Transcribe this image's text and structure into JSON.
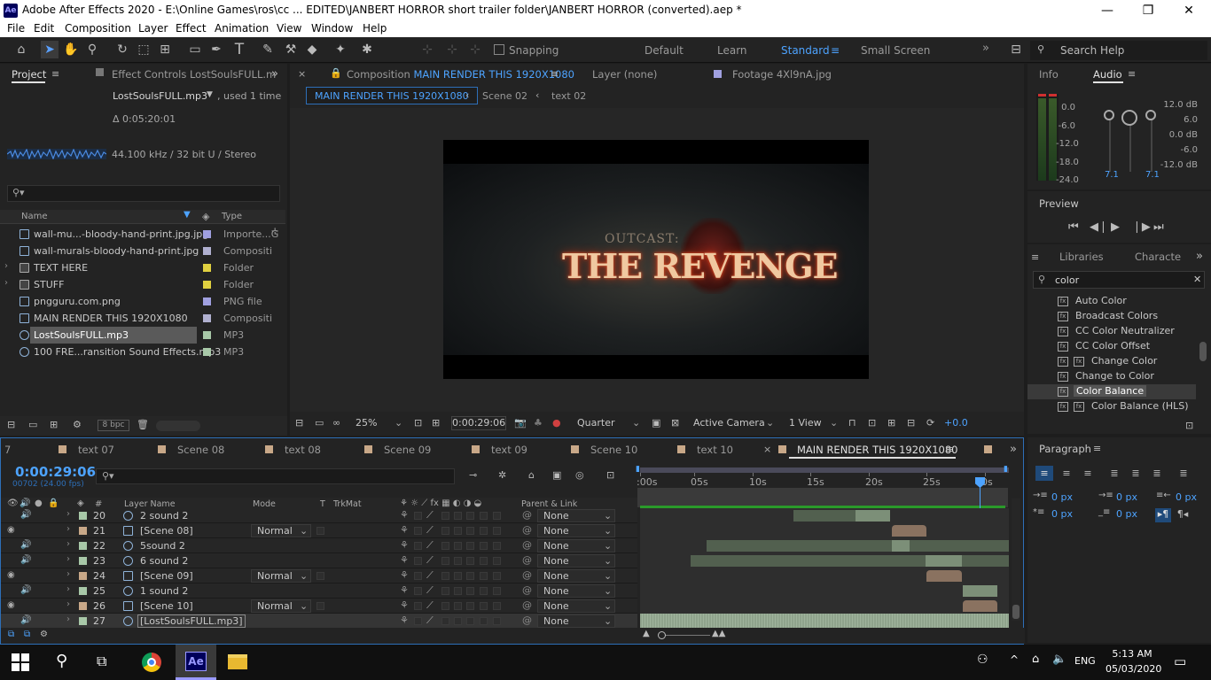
{
  "window": {
    "title": "Adobe After Effects 2020 - E:\\Online Games\\ros\\cc ... EDITED\\JANBERT HORROR short trailer folder\\JANBERT HORROR (converted).aep *",
    "logo": "Ae",
    "min": "—",
    "max": "❐",
    "close": "✕"
  },
  "menu": [
    "File",
    "Edit",
    "Composition",
    "Layer",
    "Effect",
    "Animation",
    "View",
    "Window",
    "Help"
  ],
  "toolbar": {
    "snapping": "Snapping",
    "workspaces": [
      "Default",
      "Learn",
      "Standard",
      "Small Screen"
    ],
    "active_ws": "Standard",
    "search": "Search Help"
  },
  "project": {
    "tab": "Project",
    "effect_tab": "Effect Controls LostSoulsFULL.m",
    "selected_name": "LostSoulsFULL.mp3",
    "used": ", used 1 time",
    "duration": "Δ 0:05:20:01",
    "audio_info": "44.100 kHz / 32 bit U / Stereo",
    "col_name": "Name",
    "col_type": "Type",
    "bpc": "8 bpc",
    "items": [
      {
        "name": "wall-mu...-bloody-hand-print.jpg.jpg",
        "type": "Importe...G",
        "color": "#a0a0e0",
        "kind": "img"
      },
      {
        "name": "wall-murals-bloody-hand-print.jpg",
        "type": "Compositi",
        "color": "#b0b0d0",
        "kind": "comp"
      },
      {
        "name": "TEXT HERE",
        "type": "Folder",
        "color": "#e0d040",
        "kind": "folder"
      },
      {
        "name": "STUFF",
        "type": "Folder",
        "color": "#e0d040",
        "kind": "folder"
      },
      {
        "name": "pngguru.com.png",
        "type": "PNG file",
        "color": "#a0a0e0",
        "kind": "img"
      },
      {
        "name": "MAIN RENDER THIS 1920X1080",
        "type": "Compositi",
        "color": "#b0b0d0",
        "kind": "comp"
      },
      {
        "name": "LostSoulsFULL.mp3",
        "type": "MP3",
        "color": "#a8c8a8",
        "kind": "audio",
        "selected": true
      },
      {
        "name": "100 FRE...ransition Sound Effects.mp3",
        "type": "MP3",
        "color": "#a8c8a8",
        "kind": "audio"
      }
    ]
  },
  "comp": {
    "tab_prefix": "Composition ",
    "tab_name": "MAIN RENDER THIS 1920X1080",
    "layer_tab": "Layer  (none)",
    "footage_tab": "Footage  4Xl9nA.jpg",
    "crumbs": [
      "MAIN RENDER THIS 1920X1080",
      "Scene 02",
      "text 02"
    ],
    "logo_top": "OUTCAST:",
    "logo_main": "THE REVENGE",
    "zoom": "25%",
    "time": "0:00:29:06",
    "res": "Quarter",
    "camera": "Active Camera",
    "view": "1 View",
    "exposure": "+0.0"
  },
  "info": {
    "tab": "Info",
    "audio_tab": "Audio",
    "left": [
      "0.0",
      "-6.0",
      "-12.0",
      "-18.0",
      "-24.0"
    ],
    "right": [
      "12.0 dB",
      "6.0",
      "0.0 dB",
      "-6.0",
      "-12.0 dB"
    ],
    "val1": "7.1",
    "val2": "7.1"
  },
  "preview": {
    "title": "Preview"
  },
  "libraries": {
    "tab": "Libraries",
    "char_tab": "Characte",
    "search": "color",
    "items": [
      {
        "name": "Auto Color",
        "dbl": false
      },
      {
        "name": "Broadcast Colors",
        "dbl": false
      },
      {
        "name": "CC Color Neutralizer",
        "dbl": false
      },
      {
        "name": "CC Color Offset",
        "dbl": false
      },
      {
        "name": "Change Color",
        "dbl": true
      },
      {
        "name": "Change to Color",
        "dbl": false
      },
      {
        "name": "Color Balance",
        "dbl": false,
        "sel": true
      },
      {
        "name": "Color Balance (HLS)",
        "dbl": true
      }
    ]
  },
  "paragraph": {
    "title": "Paragraph",
    "px": [
      "0 px",
      "0 px",
      "0 px",
      "0 px",
      "0 px"
    ]
  },
  "timeline": {
    "tabs": [
      "7",
      "text 07",
      "Scene 08",
      "text 08",
      "Scene 09",
      "text 09",
      "Scene 10",
      "text 10",
      "MAIN RENDER THIS 1920X1080"
    ],
    "time": "0:00:29:06",
    "frames": "00702 (24.00 fps)",
    "headers": {
      "num": "#",
      "layer": "Layer Name",
      "mode": "Mode",
      "t": "T",
      "trk": "TrkMat",
      "parent": "Parent & Link"
    },
    "ticks": [
      ":00s",
      "05s",
      "10s",
      "15s",
      "20s",
      "25s",
      "0s"
    ],
    "layers": [
      {
        "n": "20",
        "name": "2 sound 2",
        "mode": "",
        "parent": "None",
        "color": "#a8c8a8",
        "kind": "audio",
        "bar": [
          894,
          1003
        ],
        "hi": [
          964,
          1003
        ]
      },
      {
        "n": "21",
        "name": "[Scene 08]",
        "mode": "Normal",
        "parent": "None",
        "color": "#c8a888",
        "kind": "comp",
        "bar": [
          1005,
          1044
        ],
        "hi": null,
        "comp": true
      },
      {
        "n": "22",
        "name": "5sound 2",
        "mode": "",
        "parent": "None",
        "color": "#a8c8a8",
        "kind": "audio",
        "bar": [
          796,
          1137
        ],
        "hi": [
          1005,
          1025
        ]
      },
      {
        "n": "23",
        "name": "6 sound 2",
        "mode": "",
        "parent": "None",
        "color": "#a8c8a8",
        "kind": "audio",
        "bar": [
          778,
          1137
        ],
        "hi": [
          1043,
          1084
        ]
      },
      {
        "n": "24",
        "name": "[Scene 09]",
        "mode": "Normal",
        "parent": "None",
        "color": "#c8a888",
        "kind": "comp",
        "bar": [
          1044,
          1084
        ],
        "hi": null,
        "comp": true
      },
      {
        "n": "25",
        "name": "1 sound 2",
        "mode": "",
        "parent": "None",
        "color": "#a8c8a8",
        "kind": "audio",
        "bar": [
          1085,
          1124
        ],
        "hi": [
          1085,
          1124
        ]
      },
      {
        "n": "26",
        "name": "[Scene 10]",
        "mode": "Normal",
        "parent": "None",
        "color": "#c8a888",
        "kind": "comp",
        "bar": [
          1085,
          1124
        ],
        "hi": null,
        "comp": true
      },
      {
        "n": "27",
        "name": "[LostSoulsFULL.mp3]",
        "mode": "",
        "parent": "None",
        "color": "#a8c8a8",
        "kind": "audio",
        "bar": [
          721,
          1137
        ],
        "hi": null,
        "sel": true
      }
    ]
  },
  "taskbar": {
    "time": "5:13 AM",
    "date": "05/03/2020",
    "lang": "ENG"
  }
}
